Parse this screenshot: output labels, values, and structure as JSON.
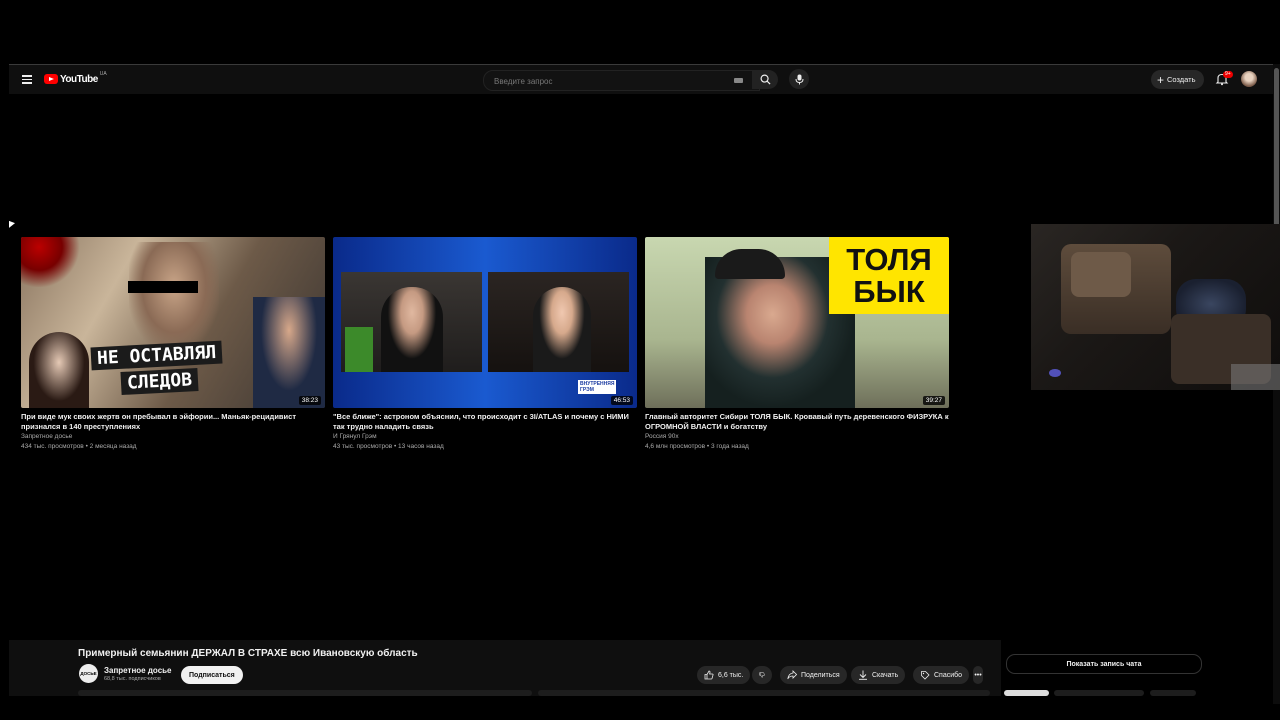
{
  "header": {
    "logo_text": "YouTube",
    "region_code": "UA",
    "search_placeholder": "Введите запрос",
    "create_label": "Создать",
    "notifications_badge": "9+"
  },
  "videos": [
    {
      "title": "При виде мук своих жертв он пребывал в эйфории... Маньяк-рецидивист признался в 140 преступлениях",
      "channel": "Запретное досье",
      "meta": "434 тыс. просмотров • 2 месяца назад",
      "duration": "38:23",
      "thumb_text_1": "НЕ ОСТАВЛЯЛ",
      "thumb_text_2": "СЛЕДОВ"
    },
    {
      "title": "\"Все ближе\": астроном объяснил, что происходит с 3I/ATLAS и почему с НИМИ так трудно наладить связь",
      "channel": "И Грянул Грэм",
      "meta": "43 тыс. просмотров • 13 часов назад",
      "duration": "46:53",
      "thumb_text_1": "ВНУТРЕННЯЯ",
      "thumb_text_2": "ГРЭМ"
    },
    {
      "title": "Главный авторитет Сибири ТОЛЯ БЫК. Кровавый путь деревенского ФИЗРУКА к ОГРОМНОЙ ВЛАСТИ и богатству",
      "channel": "Россия 90х",
      "meta": "4,6 млн просмотров • 3 года назад",
      "duration": "39:27",
      "thumb_text_1": "ТОЛЯ",
      "thumb_text_2": "БЫК"
    }
  ],
  "player": {
    "video_title": "Примерный семьянин ДЕРЖАЛ В СТРАХЕ всю Ивановскую область",
    "channel_name": "Запретное досье",
    "channel_avatar_text": "ДОСЬЕ",
    "subscribers": "68,8 тыс. подписчиков",
    "subscribe_label": "Подписаться",
    "likes": "6,6 тыс.",
    "share_label": "Поделиться",
    "download_label": "Скачать",
    "thanks_label": "Спасибо",
    "more_label": "•••",
    "show_chat_label": "Показать запись чата"
  }
}
